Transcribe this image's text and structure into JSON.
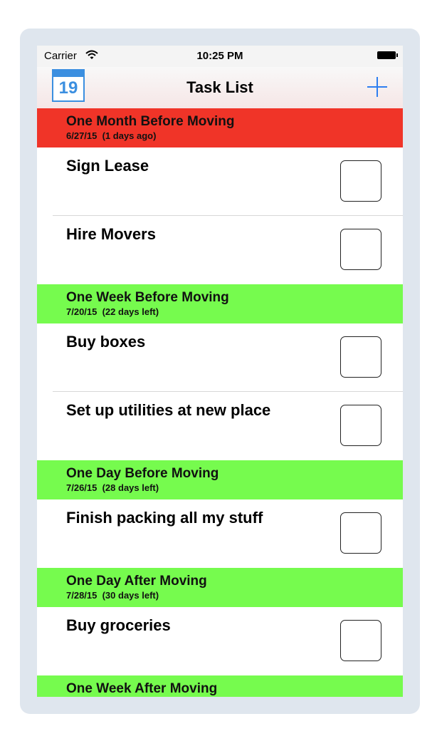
{
  "status_bar": {
    "carrier": "Carrier",
    "time": "10:25 PM"
  },
  "nav_bar": {
    "title": "Task List",
    "calendar_day": "19",
    "accent_color": "#2e7ef0"
  },
  "sections": [
    {
      "title": "One Month Before Moving",
      "date": "6/27/15  (1 days ago)",
      "color": "#f03428",
      "tasks": [
        {
          "label": "Sign Lease",
          "checked": false
        },
        {
          "label": "Hire Movers",
          "checked": false
        }
      ]
    },
    {
      "title": "One Week Before Moving",
      "date": "7/20/15  (22 days left)",
      "color": "#76fb4e",
      "tasks": [
        {
          "label": "Buy boxes",
          "checked": false
        },
        {
          "label": "Set up utilities at new place",
          "checked": false
        }
      ]
    },
    {
      "title": "One Day Before Moving",
      "date": "7/26/15  (28 days left)",
      "color": "#76fb4e",
      "tasks": [
        {
          "label": "Finish packing all my stuff",
          "checked": false
        }
      ]
    },
    {
      "title": "One Day After Moving",
      "date": "7/28/15  (30 days left)",
      "color": "#76fb4e",
      "tasks": [
        {
          "label": "Buy groceries",
          "checked": false
        }
      ]
    },
    {
      "title": "One Week After Moving",
      "date": "",
      "color": "#76fb4e",
      "tasks": []
    }
  ]
}
